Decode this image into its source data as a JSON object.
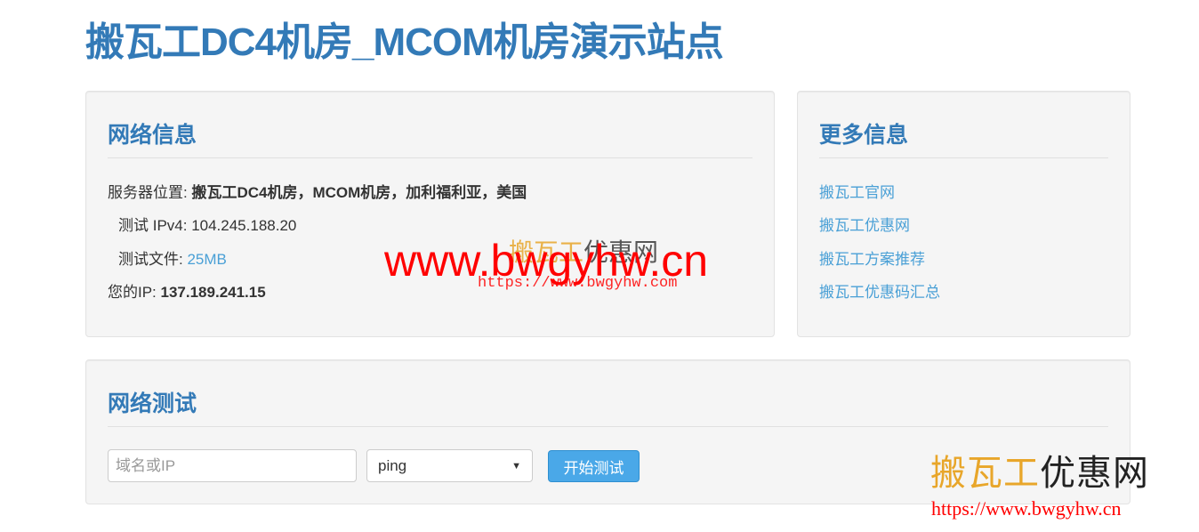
{
  "page": {
    "title": "搬瓦工DC4机房_MCOM机房演示站点"
  },
  "network_info": {
    "heading": "网络信息",
    "server_location_label": "服务器位置: ",
    "server_location_value": "搬瓦工DC4机房，MCOM机房，加利福利亚，美国",
    "ipv4_label": "测试 IPv4: ",
    "ipv4_value": "104.245.188.20",
    "file_label": "测试文件: ",
    "file_link": "25MB",
    "your_ip_label": "您的IP: ",
    "your_ip_value": "137.189.241.15"
  },
  "more_info": {
    "heading": "更多信息",
    "links": [
      "搬瓦工官网",
      "搬瓦工优惠网",
      "搬瓦工方案推荐",
      "搬瓦工优惠码汇总"
    ]
  },
  "network_test": {
    "heading": "网络测试",
    "host_placeholder": "域名或IP",
    "method_selected": "ping",
    "start_label": "开始测试"
  },
  "watermark": {
    "url_big": "www.bwgyhw.cn",
    "cn_gold": "搬瓦工",
    "cn_dark": "优惠网",
    "url_small": "https://www.bwgyhw.com",
    "corner_cn_gold": "搬瓦工",
    "corner_cn_dark": "优惠网",
    "corner_url": "https://www.bwgyhw.cn"
  },
  "colors": {
    "accent": "#337ab7",
    "link": "#4aa0d6",
    "button": "#4aa8e8",
    "watermark_red": "#ff0000",
    "watermark_gold": "#e8a62a"
  }
}
